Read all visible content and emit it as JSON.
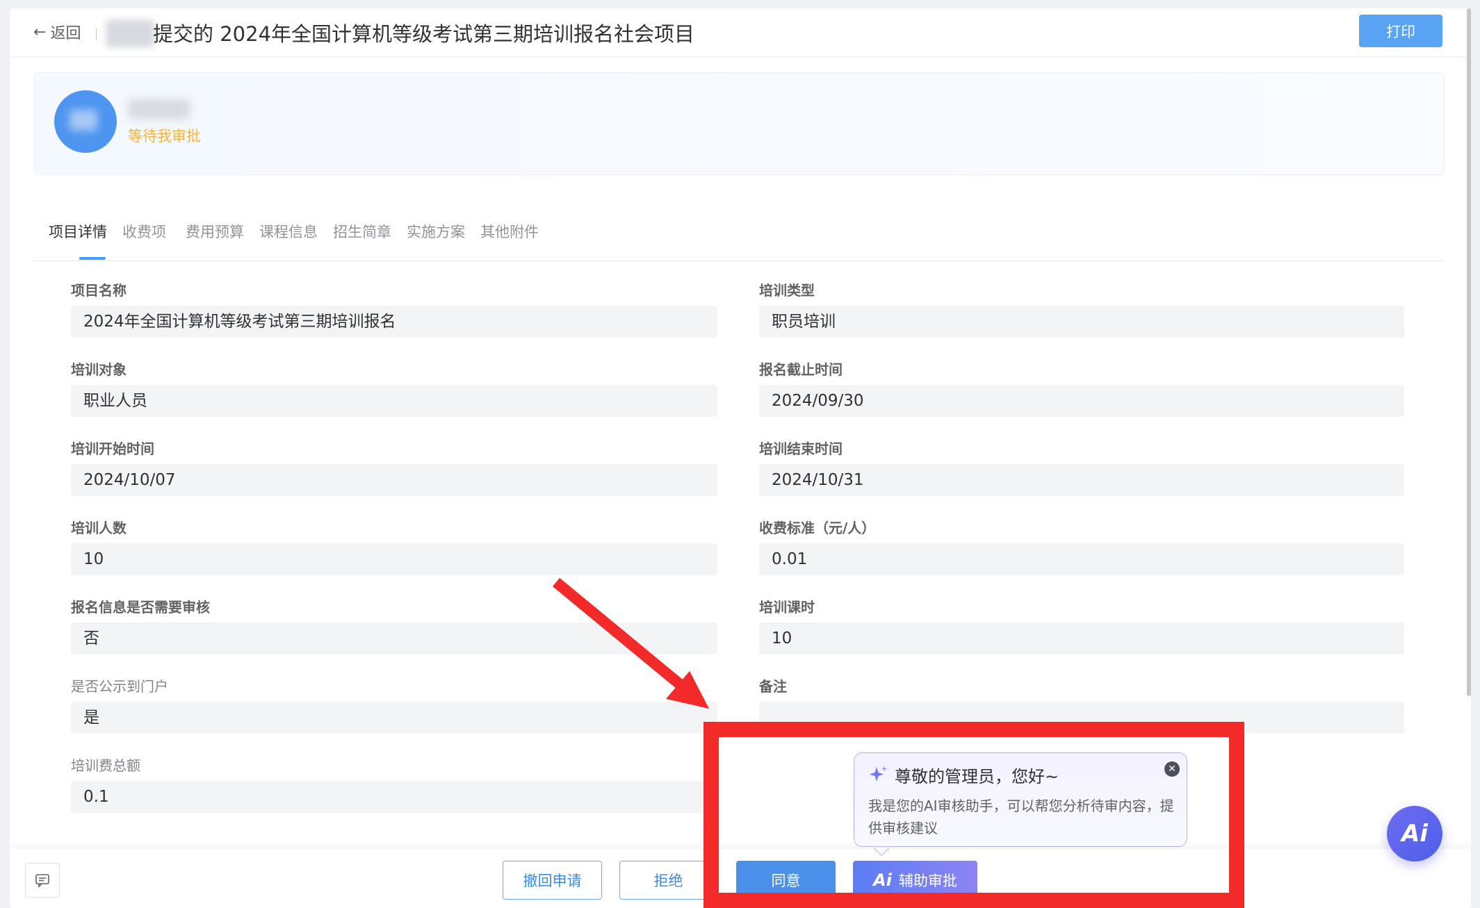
{
  "header": {
    "back_label": "返回",
    "title": "提交的 2024年全国计算机等级考试第三期培训报名社会项目",
    "print_label": "打印"
  },
  "applicant": {
    "status": "等待我审批"
  },
  "tabs": [
    {
      "label": "项目详情",
      "active": true
    },
    {
      "label": "收费项"
    },
    {
      "label": "费用预算"
    },
    {
      "label": "课程信息"
    },
    {
      "label": "招生简章"
    },
    {
      "label": "实施方案"
    },
    {
      "label": "其他附件"
    }
  ],
  "fields": {
    "project_name": {
      "label": "项目名称",
      "value": "2024年全国计算机等级考试第三期培训报名"
    },
    "training_type": {
      "label": "培训类型",
      "value": "职员培训"
    },
    "training_target": {
      "label": "培训对象",
      "value": "职业人员"
    },
    "deadline": {
      "label": "报名截止时间",
      "value": "2024/09/30"
    },
    "start_time": {
      "label": "培训开始时间",
      "value": "2024/10/07"
    },
    "end_time": {
      "label": "培训结束时间",
      "value": "2024/10/31"
    },
    "count": {
      "label": "培训人数",
      "value": "10"
    },
    "fee_standard": {
      "label": "收费标准（元/人）",
      "value": "0.01"
    },
    "need_review": {
      "label": "报名信息是否需要审核",
      "value": "否"
    },
    "hours": {
      "label": "培训课时",
      "value": "10"
    },
    "publish_portal": {
      "label": "是否公示到门户",
      "value": "是"
    },
    "remark": {
      "label": "备注",
      "value": ""
    },
    "total_fee": {
      "label": "培训费总额",
      "value": "0.1"
    }
  },
  "footer": {
    "withdraw_label": "撤回申请",
    "reject_label": "拒绝",
    "approve_label": "同意",
    "ai_assist_label": "辅助审批"
  },
  "ai_tip": {
    "title": "尊敬的管理员，您好~",
    "body": "我是您的AI审核助手，可以帮您分析待审内容，提供审核建议"
  },
  "ai_fab_label": "Ai",
  "colors": {
    "accent": "#409eff",
    "primary_button": "#4a90ea",
    "status": "#f5b53d",
    "annotation": "#f22a2a",
    "ai_gradient_start": "#5b7cf5",
    "ai_gradient_end": "#8d84f2"
  }
}
